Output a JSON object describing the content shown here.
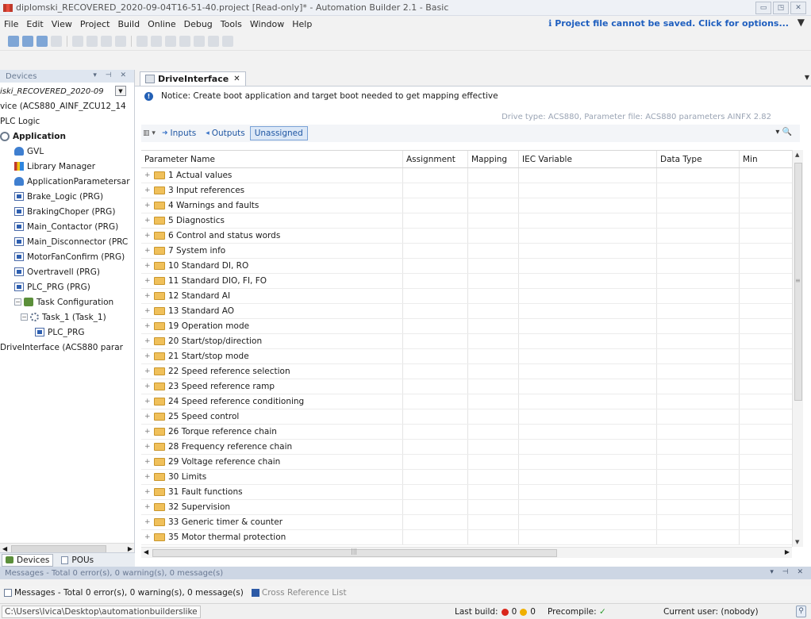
{
  "window": {
    "title": "diplomski_RECOVERED_2020-09-04T16-51-40.project [Read-only]* - Automation Builder 2.1 - Basic",
    "buttons": [
      "minimize",
      "maximize",
      "close"
    ]
  },
  "menu": {
    "items": [
      "File",
      "Edit",
      "View",
      "Project",
      "Build",
      "Online",
      "Debug",
      "Tools",
      "Window",
      "Help"
    ],
    "warning": "Project file cannot be saved. Click for options..."
  },
  "devices_panel": {
    "title": "Devices",
    "project_combo": "iski_RECOVERED_2020-09",
    "tree": [
      {
        "label": "vice (ACS880_AINF_ZCU12_14",
        "icon": "device-icon",
        "indent": 0
      },
      {
        "label": "PLC Logic",
        "icon": "",
        "indent": 0
      },
      {
        "label": "Application",
        "icon": "application-icon",
        "indent": 0,
        "bold": true
      },
      {
        "label": "GVL",
        "icon": "gvl-icon",
        "indent": 1
      },
      {
        "label": "Library Manager",
        "icon": "library-icon",
        "indent": 1
      },
      {
        "label": "ApplicationParametersar",
        "icon": "gvl-icon",
        "indent": 1
      },
      {
        "label": "Brake_Logic (PRG)",
        "icon": "prg-icon",
        "indent": 1
      },
      {
        "label": "BrakingChoper (PRG)",
        "icon": "prg-icon",
        "indent": 1
      },
      {
        "label": "Main_Contactor (PRG)",
        "icon": "prg-icon",
        "indent": 1
      },
      {
        "label": "Main_Disconnector (PRC",
        "icon": "prg-icon",
        "indent": 1
      },
      {
        "label": "MotorFanConfirm (PRG)",
        "icon": "prg-icon",
        "indent": 1
      },
      {
        "label": "Overtravell (PRG)",
        "icon": "prg-icon",
        "indent": 1
      },
      {
        "label": "PLC_PRG (PRG)",
        "icon": "prg-icon",
        "indent": 1
      },
      {
        "label": "Task Configuration",
        "icon": "task-config-icon",
        "indent": 1,
        "expander": "−"
      },
      {
        "label": "Task_1 (Task_1)",
        "icon": "gear-icon",
        "indent": 2,
        "expander": "−"
      },
      {
        "label": "PLC_PRG",
        "icon": "prg-icon",
        "indent": 3
      },
      {
        "label": "DriveInterface (ACS880 parar",
        "icon": "",
        "indent": 0
      }
    ],
    "tabs": [
      "Devices",
      "POUs"
    ]
  },
  "editor": {
    "tab_label": "DriveInterface",
    "notice": "Notice: Create boot application and target boot needed to get mapping effective",
    "drive_info": "Drive type: ACS880, Parameter file: ACS880 parameters AINFX 2.82",
    "filter": {
      "inputs": "Inputs",
      "outputs": "Outputs",
      "unassigned": "Unassigned"
    },
    "columns": [
      "Parameter Name",
      "Assignment",
      "Mapping",
      "IEC Variable",
      "Data Type",
      "Min"
    ],
    "rows": [
      "1 Actual values",
      "3 Input references",
      "4 Warnings and faults",
      "5 Diagnostics",
      "6 Control and status words",
      "7 System info",
      "10 Standard DI, RO",
      "11 Standard DIO, FI, FO",
      "12 Standard AI",
      "13 Standard AO",
      "19 Operation mode",
      "20 Start/stop/direction",
      "21 Start/stop mode",
      "22 Speed reference selection",
      "23 Speed reference ramp",
      "24 Speed reference conditioning",
      "25 Speed control",
      "26 Torque reference chain",
      "28 Frequency reference chain",
      "29 Voltage reference chain",
      "30 Limits",
      "31 Fault functions",
      "32 Supervision",
      "33 Generic timer & counter",
      "35 Motor thermal protection"
    ]
  },
  "messages": {
    "header": "Messages - Total 0 error(s), 0 warning(s), 0 message(s)",
    "tab_messages": "Messages - Total 0 error(s), 0 warning(s), 0 message(s)",
    "tab_crossref": "Cross Reference List"
  },
  "status": {
    "path": "C:\\Users\\Ivica\\Desktop\\automationbuilderslike",
    "last_build_label": "Last build:",
    "errors": "0",
    "warnings": "0",
    "precompile_label": "Precompile:",
    "precompile_mark": "✓",
    "user": "Current user: (nobody)"
  }
}
